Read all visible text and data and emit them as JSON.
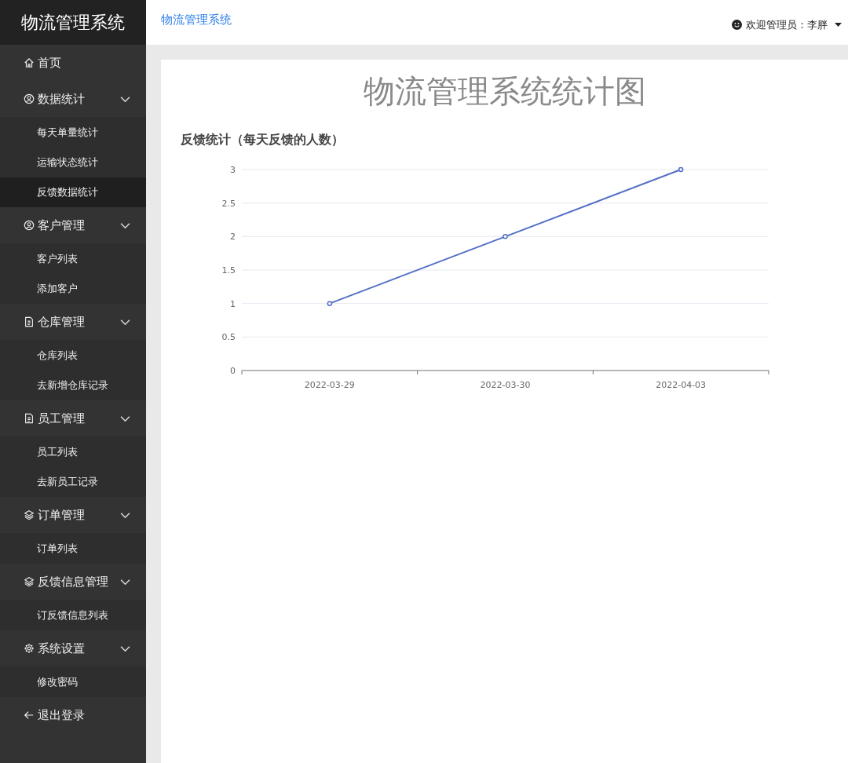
{
  "sidebar": {
    "logo": "物流管理系统",
    "items": [
      {
        "label": "首页",
        "selected": false
      },
      {
        "label": "数据统计",
        "selected": false,
        "expanded": true,
        "children": [
          {
            "label": "每天单量统计",
            "selected": false
          },
          {
            "label": "运输状态统计",
            "selected": false
          },
          {
            "label": "反馈数据统计",
            "selected": true
          }
        ]
      },
      {
        "label": "客户管理",
        "selected": false,
        "expanded": true,
        "children": [
          {
            "label": "客户列表",
            "selected": false
          },
          {
            "label": "添加客户",
            "selected": false
          }
        ]
      },
      {
        "label": "仓库管理",
        "selected": false,
        "expanded": true,
        "children": [
          {
            "label": "仓库列表",
            "selected": false
          },
          {
            "label": "去新增仓库记录",
            "selected": false
          }
        ]
      },
      {
        "label": "员工管理",
        "selected": false,
        "expanded": true,
        "children": [
          {
            "label": "员工列表",
            "selected": false
          },
          {
            "label": "去新员工记录",
            "selected": false
          }
        ]
      },
      {
        "label": "订单管理",
        "selected": false,
        "expanded": true,
        "children": [
          {
            "label": "订单列表",
            "selected": false
          }
        ]
      },
      {
        "label": "反馈信息管理",
        "selected": false,
        "expanded": true,
        "children": [
          {
            "label": "订反馈信息列表",
            "selected": false
          }
        ]
      },
      {
        "label": "系统设置",
        "selected": false,
        "expanded": true,
        "children": [
          {
            "label": "修改密码",
            "selected": false
          }
        ]
      },
      {
        "label": "退出登录",
        "selected": false
      }
    ]
  },
  "header": {
    "breadcrumb": "物流管理系统",
    "user": "欢迎管理员：李胖"
  },
  "main": {
    "heading": "物流管理系统统计图",
    "chart_data": {
      "type": "line",
      "title": "反馈统计（每天反馈的人数）",
      "categories": [
        "2022-03-29",
        "2022-03-30",
        "2022-04-03"
      ],
      "series": [
        {
          "color": "#5470c6",
          "marker": true,
          "values": [
            1,
            2,
            3
          ]
        }
      ],
      "grid": true,
      "yticks": [
        0,
        0.5,
        1,
        1.5,
        2,
        2.5,
        3
      ],
      "ylim": [
        0,
        3
      ]
    }
  }
}
